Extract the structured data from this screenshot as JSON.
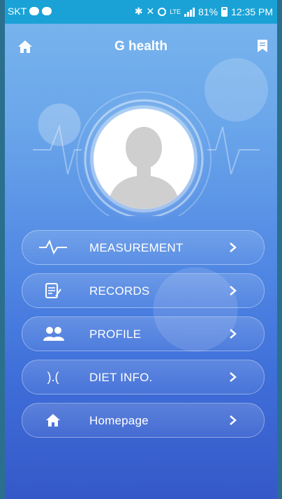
{
  "status_bar": {
    "carrier": "SKT",
    "network": "LTE",
    "battery": "81%",
    "time": "12:35 PM"
  },
  "header": {
    "title": "G health"
  },
  "menu": {
    "items": [
      {
        "label": "MEASUREMENT",
        "icon": "pulse-icon"
      },
      {
        "label": "RECORDS",
        "icon": "notepad-icon"
      },
      {
        "label": "PROFILE",
        "icon": "users-icon"
      },
      {
        "label": "DIET INFO.",
        "icon": "diet-icon",
        "glyph": ").("
      },
      {
        "label": "Homepage",
        "icon": "home-icon"
      }
    ]
  },
  "colors": {
    "status_bar": "#1aa2d6",
    "background_top": "#79b6ee",
    "background_bottom": "#3558c8"
  }
}
